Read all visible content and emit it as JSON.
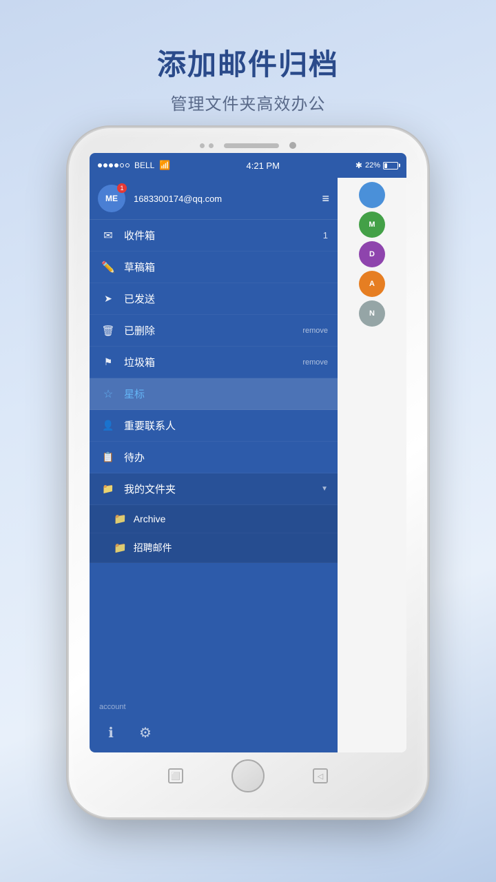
{
  "page": {
    "main_title": "添加邮件归档",
    "sub_title": "管理文件夹高效办公"
  },
  "status_bar": {
    "carrier": "BELL",
    "time": "4:21 PM",
    "battery_percent": "22%",
    "signal_dots": [
      "filled",
      "filled",
      "filled",
      "filled",
      "empty",
      "empty"
    ]
  },
  "sidebar": {
    "email": "1683300174@qq.com",
    "avatar_text": "ME",
    "badge": "1",
    "menu_icon": "≡",
    "items": [
      {
        "id": "inbox",
        "icon": "✉",
        "label": "收件箱",
        "badge": "1",
        "remove": ""
      },
      {
        "id": "drafts",
        "icon": "✏",
        "label": "草稿箱",
        "badge": "",
        "remove": ""
      },
      {
        "id": "sent",
        "icon": "✈",
        "label": "已发送",
        "badge": "",
        "remove": ""
      },
      {
        "id": "deleted",
        "icon": "🗑",
        "label": "已删除",
        "badge": "",
        "remove": "remove"
      },
      {
        "id": "spam",
        "icon": "⚑",
        "label": "垃圾箱",
        "badge": "",
        "remove": "remove"
      },
      {
        "id": "starred",
        "icon": "☆",
        "label": "星标",
        "badge": "",
        "remove": "",
        "active": true
      },
      {
        "id": "vip",
        "icon": "👤",
        "label": "重要联系人",
        "badge": "",
        "remove": ""
      },
      {
        "id": "todo",
        "icon": "📋",
        "label": "待办",
        "badge": "",
        "remove": ""
      },
      {
        "id": "myfolder",
        "icon": "📁",
        "label": "我的文件夹",
        "badge": "",
        "remove": "",
        "has_dropdown": true
      }
    ],
    "subfolders": [
      {
        "id": "archive",
        "icon": "📁",
        "label": "Archive"
      },
      {
        "id": "recruitment",
        "icon": "📁",
        "label": "招聘邮件"
      }
    ],
    "footer_icons": [
      "ℹ",
      "⚙"
    ],
    "account_label": "account"
  },
  "floating_avatars": [
    {
      "color": "#4a90d9",
      "text": ""
    },
    {
      "color": "#43a047",
      "text": "M"
    },
    {
      "color": "#8e44ad",
      "text": "D"
    },
    {
      "color": "#e67e22",
      "text": "A"
    },
    {
      "color": "#95a5a6",
      "text": "N"
    }
  ]
}
